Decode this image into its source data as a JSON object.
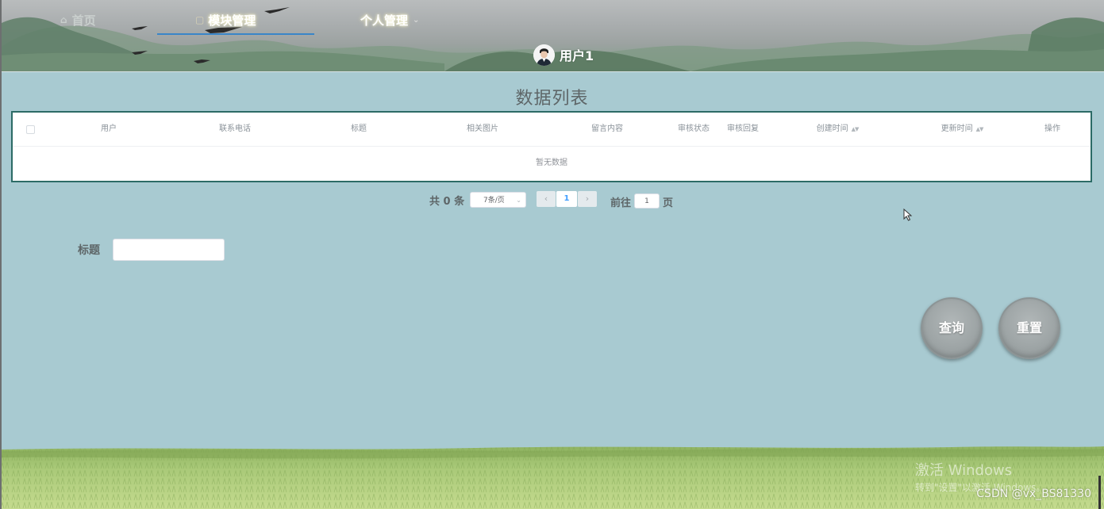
{
  "nav": {
    "home": "首页",
    "module": "模块管理",
    "personal": "个人管理",
    "user": "用户1"
  },
  "page": {
    "title": "数据列表"
  },
  "table": {
    "columns": [
      "用户",
      "联系电话",
      "标题",
      "相关图片",
      "留言内容",
      "审核状态",
      "审核回复",
      "创建时间",
      "更新时间",
      "操作"
    ],
    "empty_text": "暂无数据"
  },
  "pagination": {
    "total": "共 0 条",
    "page_size": "7条/页",
    "current_page": "1",
    "goto_label": "前往",
    "goto_value": "1",
    "goto_suffix": "页"
  },
  "search": {
    "label": "标题",
    "value": "",
    "query_button": "查询",
    "reset_button": "重置"
  },
  "overlay": {
    "activate_title": "激活 Windows",
    "activate_sub": "转到\"设置\"以激活 Windows。",
    "credit": "CSDN @vx_BS81330"
  },
  "colors": {
    "background": "#a8cad1",
    "table_border": "#2c6b66",
    "active_underline": "#3a86c8",
    "button": "#9ea5a6"
  },
  "icons": [
    "home-icon",
    "module-icon",
    "chevron-down-icon",
    "sort-icon",
    "chevron-left-icon",
    "chevron-right-icon",
    "cursor-icon"
  ]
}
